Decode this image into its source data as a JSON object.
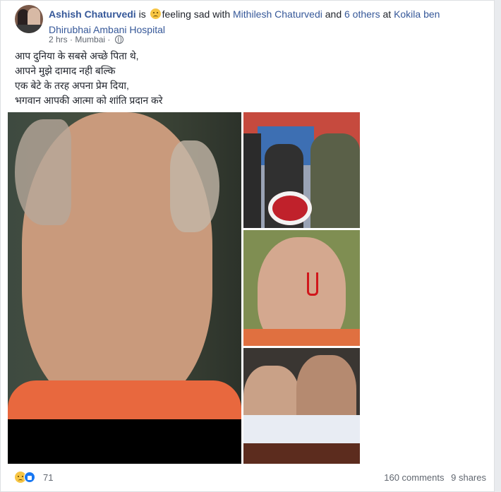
{
  "post": {
    "author": "Ashish Chaturvedi",
    "is_text": "is",
    "feeling": "feeling sad",
    "with_text": "with",
    "tagged_person": "Mithilesh Chaturvedi",
    "and_text": "and",
    "others": "6 others",
    "at_text": "at",
    "place_line1": "Kokila ben",
    "place_line2": "Dhirubhai Ambani Hospital",
    "time": "2 hrs",
    "location": "Mumbai",
    "privacy_icon": "globe-icon",
    "text_lines": [
      "आप दुनिया के सबसे अच्छे पिता थे,",
      "आपने मुझे दामाद नही बल्कि",
      "एक बेटे के तरह अपना प्रेम दिया,",
      "भगवान आपकी आत्मा को शांति प्रदान करे"
    ]
  },
  "reactions": {
    "icons": [
      "sad-reaction-icon",
      "like-reaction-icon"
    ],
    "count": "71"
  },
  "stats": {
    "comments": "160 comments",
    "shares": "9 shares"
  },
  "colors": {
    "link": "#365899",
    "text": "#1d2129",
    "meta": "#616770",
    "background": "#e9ebee"
  }
}
